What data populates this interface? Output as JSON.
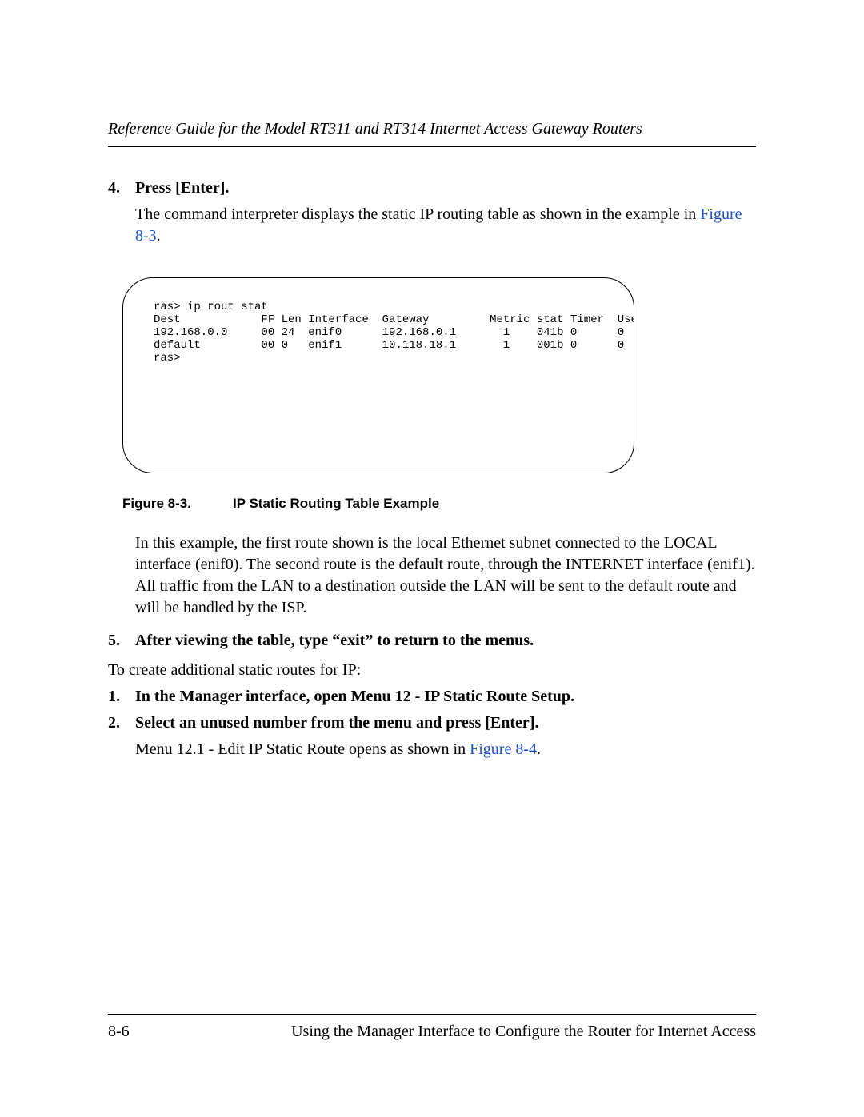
{
  "header": {
    "running_title": "Reference Guide for the Model RT311 and RT314 Internet Access Gateway Routers"
  },
  "step4": {
    "num": "4.",
    "title": "Press [Enter].",
    "body_before_link": "The command interpreter displays the static IP routing table as shown in the example in ",
    "link": "Figure 8-3",
    "body_after_link": "."
  },
  "figure": {
    "terminal": "ras> ip rout stat\nDest            FF Len Interface  Gateway         Metric stat Timer  Use\n192.168.0.0     00 24  enif0      192.168.0.1       1    041b 0      0\ndefault         00 0   enif1      10.118.18.1       1    001b 0      0\nras>",
    "label": "Figure 8-3.",
    "caption": "IP Static Routing Table Example"
  },
  "explain": "In this example, the first route shown is the local Ethernet subnet connected to the LOCAL interface (enif0). The second route is the default route, through the INTERNET interface (enif1). All traffic from the LAN to a destination outside the LAN will be sent to the default route and will be handled by the ISP.",
  "step5": {
    "num": "5.",
    "title": "After viewing the table, type “exit” to return to the menus."
  },
  "intro2": "To create additional static routes for IP:",
  "stepB1": {
    "num": "1.",
    "title": "In the Manager interface, open Menu 12 - IP Static Route Setup."
  },
  "stepB2": {
    "num": "2.",
    "title": "Select an unused number from the menu and press [Enter].",
    "body_before_link": "Menu 12.1 - Edit IP Static Route opens as shown in ",
    "link": "Figure 8-4",
    "body_after_link": "."
  },
  "footer": {
    "page": "8-6",
    "section": "Using the Manager Interface to Configure the Router for Internet Access"
  }
}
